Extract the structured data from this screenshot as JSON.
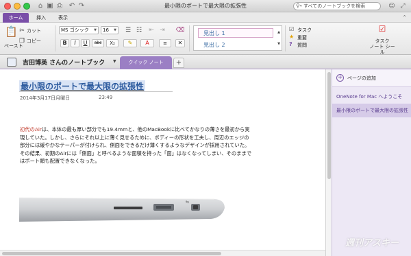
{
  "window": {
    "title": "最小限のポートで最大限の拡張性",
    "search_placeholder": "すべてのノートブックを検索"
  },
  "ribbon_tabs": [
    {
      "label": "ホーム",
      "active": true
    },
    {
      "label": "挿入",
      "active": false
    },
    {
      "label": "表示",
      "active": false
    }
  ],
  "ribbon": {
    "paste_label": "ペースト",
    "cut_label": "カット",
    "copy_label": "コピー",
    "font_name": "MS ゴシック",
    "font_size": "16",
    "styles": [
      "見出し 1",
      "見出し 2"
    ],
    "tags": [
      "タスク",
      "重要",
      "質問"
    ],
    "task_tag_label": "タスク\nノート シール"
  },
  "notebook": {
    "title": "吉田博英 さんのノートブック",
    "section_tab": "クイック ノート",
    "add_section": "+"
  },
  "page": {
    "title": "最小限のポートで最大限の拡張性",
    "date": "2014年3月17日月曜日",
    "time": "23:49",
    "body_highlight": "初代のAir",
    "body_rest": "は、本体の最も厚い部分でも19.4mmと、他のMacBookに比べてかなりの薄さを最初から実現していた。しかし、さらにそれ以上に薄く見せるために、ボディーの形状を工夫し、周辺のエッジの部分には緩やかなテーパーが付けられ、側面をできるだけ薄くするようなデザインが採用されていた。その結果、初期のAirには「側面」と呼べるような面積を持った「面」はなくなってしまい、そのままではポート類も配置できなくなった。"
  },
  "page_list": {
    "add_page_label": "ページの追加",
    "items": [
      {
        "label": "OneNote for Mac へようこそ",
        "active": false
      },
      {
        "label": "最小限のポートで最大限の拡張性",
        "active": true
      }
    ]
  },
  "watermark": "週刊アスキー",
  "colors": {
    "accent": "#7a4fa8",
    "section_tab": "#9b7fc4",
    "title_text": "#2b5a9e",
    "highlight_text": "#c0392b"
  }
}
